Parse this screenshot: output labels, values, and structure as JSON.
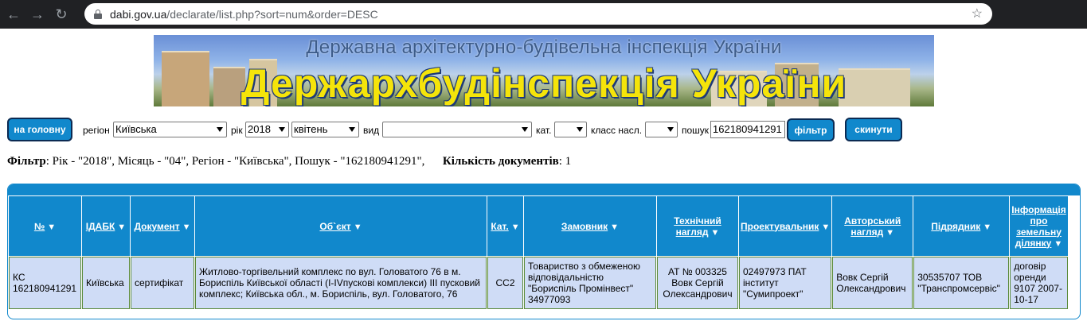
{
  "browser": {
    "url_domain": "dabi.gov.ua",
    "url_path": "/declarate/list.php?sort=num&order=DESC"
  },
  "banner": {
    "subtitle": "Державна архітектурно-будівельна інспекція України",
    "title": "Держархбудінспекція України"
  },
  "filters": {
    "home_button": "на головну",
    "region_label": "регіон",
    "region_value": "Київська",
    "year_label": "рік",
    "year_value": "2018",
    "month_value": "квітень",
    "type_label": "вид",
    "type_value": "",
    "cat_label": "кат.",
    "cat_value": "",
    "class_label": "класс насл.",
    "class_value": "",
    "search_label": "пошук",
    "search_value": "162180941291",
    "filter_button": "фільтр",
    "reset_button": "скинути"
  },
  "summary": {
    "filter_label": "Фільтр",
    "filter_text": ": Рік - \"2018\", Місяць - \"04\", Регіон - \"Київська\", Пошук - \"162180941291\",",
    "count_label": "Кількість документів",
    "count_text": ": 1"
  },
  "table": {
    "headers": [
      {
        "lines": [
          "№"
        ]
      },
      {
        "lines": [
          "ІДАБК"
        ]
      },
      {
        "lines": [
          "Документ"
        ]
      },
      {
        "lines": [
          "Об`єкт"
        ]
      },
      {
        "lines": [
          "Кат."
        ]
      },
      {
        "lines": [
          "Замовник"
        ]
      },
      {
        "lines": [
          "Технічний",
          "нагляд"
        ]
      },
      {
        "lines": [
          "Проектувальник"
        ]
      },
      {
        "lines": [
          "Авторський",
          "нагляд"
        ]
      },
      {
        "lines": [
          "Підрядник"
        ]
      },
      {
        "lines": [
          "Інформація",
          "про",
          "земельну",
          "ділянку"
        ]
      }
    ],
    "rows": [
      {
        "num": "КС 162180941291",
        "idabk": "Київська",
        "doc": "сертифікат",
        "object": "Житлово-торгівельний комплекс по вул. Головатого 76 в м. Бориспіль Київської області (І-ІVпускові комплекси) ІІІ пусковий комплекс; Київська обл., м. Бориспіль, вул. Головатого, 76",
        "cat": "СС2",
        "customer": "Товариство з обмеженою відповідальністю \"Бориспіль Промінвест\" 34977093",
        "tech": "АТ № 003325 Вовк Сергій Олександрович",
        "designer": "02497973 ПАТ інститут \"Сумипроект\"",
        "author": "Вовк Сергій Олександрович",
        "contractor": "30535707 ТОВ \"Транспромсервіс\"",
        "land": "договір оренди 9107 2007-10-17"
      }
    ]
  }
}
